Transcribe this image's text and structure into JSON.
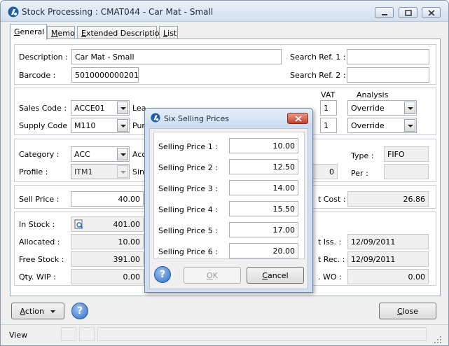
{
  "window": {
    "title": "Stock Processing : CMAT044 - Car Mat - Small"
  },
  "tabs": [
    {
      "label": "General",
      "ul": "G",
      "rest": "eneral"
    },
    {
      "label": "Memo",
      "ul": "M",
      "rest": "emo"
    },
    {
      "label": "Extended Description",
      "ul": "E",
      "rest": "xtended Description"
    },
    {
      "label": "List",
      "ul": "L",
      "rest": "ist"
    }
  ],
  "general": {
    "description_label": "Description :",
    "description_value": "Car Mat - Small",
    "barcode_label": "Barcode :",
    "barcode_value": "5010000000201",
    "search_ref1_label": "Search Ref. 1 :",
    "search_ref1_value": "",
    "search_ref2_label": "Search Ref. 2 :",
    "search_ref2_value": "",
    "vat_header": "VAT",
    "analysis_header": "Analysis",
    "sales_code_label": "Sales Code :",
    "sales_code_value": "ACCE01",
    "supply_code_label": "Supply Code :",
    "supply_code_value": "M110",
    "lea_fragment": "Lea",
    "pur_fragment": "Pur",
    "vat1_value": "1",
    "vat2_value": "1",
    "analysis1_value": "Override",
    "analysis2_value": "Override",
    "category_label": "Category :",
    "category_value": "ACC",
    "profile_label": "Profile :",
    "profile_value": "ITM1",
    "acc_fragment": "Acc",
    "sin_fragment": "Sin",
    "zero_value": "0",
    "type_label": "Type :",
    "type_value": "FIFO",
    "per_label": "Per :",
    "per_value": "",
    "sell_price_label": "Sell Price :",
    "sell_price_value": "40.00",
    "cost_label_fragment": "t Cost :",
    "cost_value": "26.86",
    "in_stock_label": "In Stock :",
    "in_stock_value": "401.00",
    "allocated_label": "Allocated :",
    "allocated_value": "10.00",
    "free_stock_label": "Free Stock :",
    "free_stock_value": "391.00",
    "qty_wip_label": "Qty. WIP :",
    "qty_wip_value": "0.00",
    "last_iss_label_fragment": "t Iss. :",
    "last_iss_value": "12/09/2011",
    "last_rec_label_fragment": "t Rec. :",
    "last_rec_value": "12/09/2011",
    "wo_label_fragment": ". WO :",
    "wo_value": "0.00"
  },
  "footer": {
    "action_label": "Action",
    "action_ul": "A",
    "action_rest": "ction",
    "close_label": "Close",
    "close_ul": "C",
    "close_rest": "lose"
  },
  "statusbar": {
    "text": "View"
  },
  "dialog": {
    "title": "Six Selling Prices",
    "prices": [
      {
        "label": "Selling Price 1 :",
        "value": "10.00"
      },
      {
        "label": "Selling Price 2 :",
        "value": "12.50"
      },
      {
        "label": "Selling Price 3 :",
        "value": "14.00"
      },
      {
        "label": "Selling Price 4 :",
        "value": "15.50"
      },
      {
        "label": "Selling Price 5 :",
        "value": "17.00"
      },
      {
        "label": "Selling Price 6 :",
        "value": "20.00"
      }
    ],
    "ok_label": "OK",
    "ok_ul": "O",
    "ok_rest": "K",
    "cancel_label": "Cancel",
    "cancel_ul": "C",
    "cancel_rest": "ancel"
  },
  "colors": {
    "accent": "#2f6fc6",
    "close_red": "#c4402a",
    "dialog_frame": "#cfdff1"
  }
}
